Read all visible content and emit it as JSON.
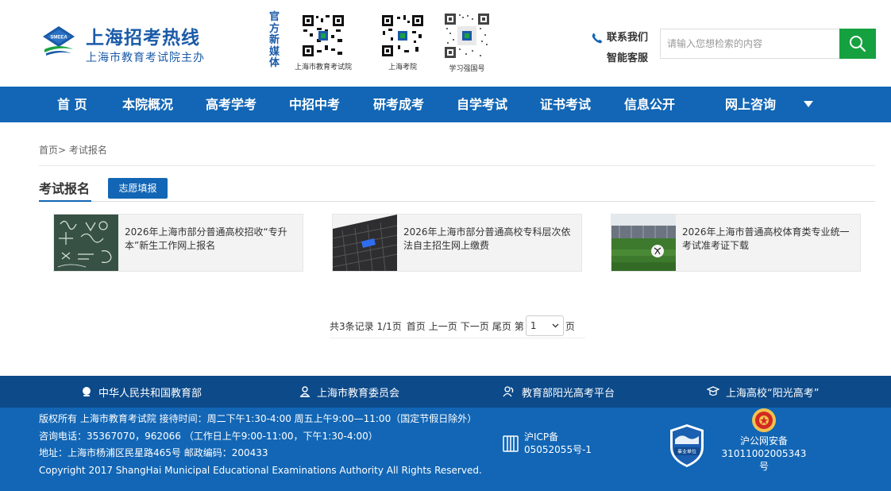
{
  "header": {
    "logo": {
      "title": "上海招考热线",
      "subtitle": "上海市教育考试院主办",
      "emblem_text": "SMEEA"
    },
    "media_label": "官方新媒体",
    "qr_codes": [
      {
        "caption": "上海市教育考试院"
      },
      {
        "caption": "上海考院"
      },
      {
        "caption": "学习强国号"
      }
    ],
    "contact": {
      "contact_us": "联系我们",
      "smart_service": "智能客服"
    },
    "search": {
      "placeholder": "请输入您想检索的内容",
      "value": ""
    }
  },
  "nav": {
    "items": [
      {
        "label": "首 页"
      },
      {
        "label": "本院概况"
      },
      {
        "label": "高考学考"
      },
      {
        "label": "中招中考"
      },
      {
        "label": "研考成考"
      },
      {
        "label": "自学考试"
      },
      {
        "label": "证书考试"
      },
      {
        "label": "信息公开"
      },
      {
        "label": "网上咨询"
      }
    ]
  },
  "breadcrumb": "首页> 考试报名",
  "section": {
    "title": "考试报名",
    "tab_button": "志愿填报"
  },
  "articles": [
    {
      "title": "2026年上海市部分普通高校招收“专升本”新生工作网上报名"
    },
    {
      "title": "2026年上海市部分普通高校专科层次依法自主招生网上缴费"
    },
    {
      "title": "2026年上海市普通高校体育类专业统一考试准考证下载"
    }
  ],
  "pagination": {
    "summary": "共3条记录 1/1页",
    "first": "首页",
    "prev": "上一页",
    "next": "下一页",
    "last": "尾页",
    "page_prefix": "第",
    "page_value": "1",
    "page_suffix": "页"
  },
  "footer_links": [
    {
      "label": "中华人民共和国教育部"
    },
    {
      "label": "上海市教育委员会"
    },
    {
      "label": "教育部阳光高考平台"
    },
    {
      "label": "上海高校“阳光高考”"
    }
  ],
  "footer": {
    "lines": [
      "版权所有  上海市教育考试院 接待时间：周二下午1:30-4:00 周五上午9:00—11:00（国定节假日除外）",
      "咨询电话：35367070，962066 （工作日上午9:00-11:00，下午1:30-4:00）",
      "地址：上海市杨浦区民星路465号 邮政编码：200433",
      "Copyright 2017 ShangHai Municipal Educational Examinations Authority All Rights Reserved."
    ],
    "icp": {
      "line1": "沪ICP备",
      "line2": "05052055号-1"
    },
    "badge_text": "事业单位",
    "police": {
      "line1": "沪公网安备",
      "line2": "31011002005343",
      "line3": "号"
    }
  },
  "colors": {
    "brand_blue": "#1266b5",
    "dark_blue": "#0c4a8a",
    "search_green": "#16a140",
    "logo_blue": "#1a5aa8"
  }
}
